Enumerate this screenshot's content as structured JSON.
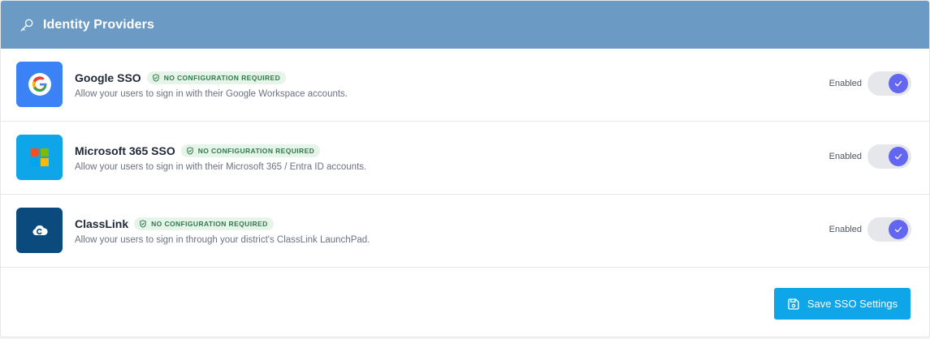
{
  "header": {
    "title": "Identity Providers",
    "icon": "key-icon"
  },
  "providers": [
    {
      "name": "Google SSO",
      "badge": "NO CONFIGURATION REQUIRED",
      "description": "Allow your users to sign in with their Google Workspace accounts.",
      "toggle_label": "Enabled",
      "enabled": true,
      "logo_color": "#3b82f6",
      "icon": "google-icon"
    },
    {
      "name": "Microsoft 365 SSO",
      "badge": "NO CONFIGURATION REQUIRED",
      "description": "Allow your users to sign in with their Microsoft 365 / Entra ID accounts.",
      "toggle_label": "Enabled",
      "enabled": true,
      "logo_color": "#0ea5e9",
      "icon": "microsoft-icon"
    },
    {
      "name": "ClassLink",
      "badge": "NO CONFIGURATION REQUIRED",
      "description": "Allow your users to sign in through your district's ClassLink LaunchPad.",
      "toggle_label": "Enabled",
      "enabled": true,
      "logo_color": "#0b4a7d",
      "icon": "classlink-icon"
    }
  ],
  "footer": {
    "save_label": "Save SSO Settings",
    "save_icon": "save-icon"
  },
  "colors": {
    "header_bg": "#6b9ac4",
    "badge_bg": "#e6f4ea",
    "badge_text": "#2f7a4a",
    "toggle_on": "#6366f1",
    "save_button": "#0ea5e9"
  }
}
